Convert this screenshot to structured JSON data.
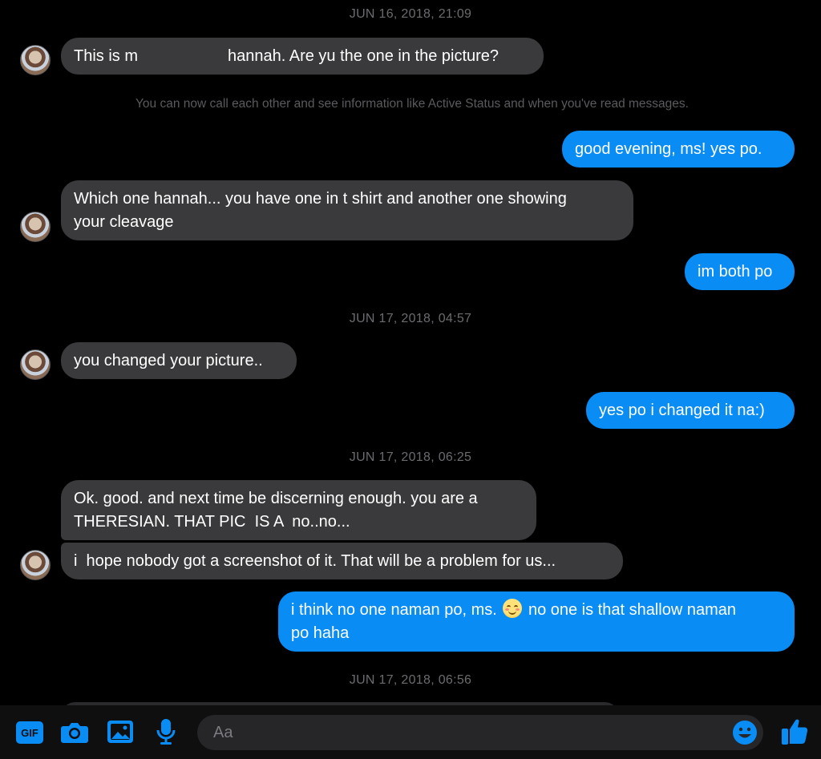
{
  "timestamps": [
    "JUN 16, 2018, 21:09",
    "JUN 17, 2018, 04:57",
    "JUN 17, 2018, 06:25",
    "JUN 17, 2018, 06:56"
  ],
  "system_note": "You can now call each other and see information like Active Status and when you've read messages.",
  "messages": {
    "m1_pre": "This is m",
    "m1_post": "hannah. Are yu the one in the picture?",
    "m2": "good evening, ms! yes po.",
    "m3": "Which one hannah... you have one in t shirt and another one showing\nyour cleavage",
    "m4": "im both po",
    "m5": "you changed your picture..",
    "m6": "yes po i changed it na:)",
    "m7": "Ok. good. and next time be discerning enough. you are a\nTHERESIAN. THAT PIC  IS A  no..no...",
    "m8": "i  hope nobody got a screenshot of it. That will be a problem for us...",
    "m9_pre": "i think no one naman po, ms.",
    "m9_post": "no one is that shallow naman\npo haha"
  },
  "composer": {
    "placeholder": "Aa",
    "gif_label": "GIF"
  },
  "colors": {
    "background": "#000000",
    "incoming_bubble": "#3a3a3c",
    "outgoing_bubble": "#0a8cf5",
    "accent": "#0a8cf5"
  },
  "icons": [
    "gif-icon",
    "camera-icon",
    "image-icon",
    "microphone-icon",
    "emoji-icon",
    "thumbs-up-icon"
  ]
}
